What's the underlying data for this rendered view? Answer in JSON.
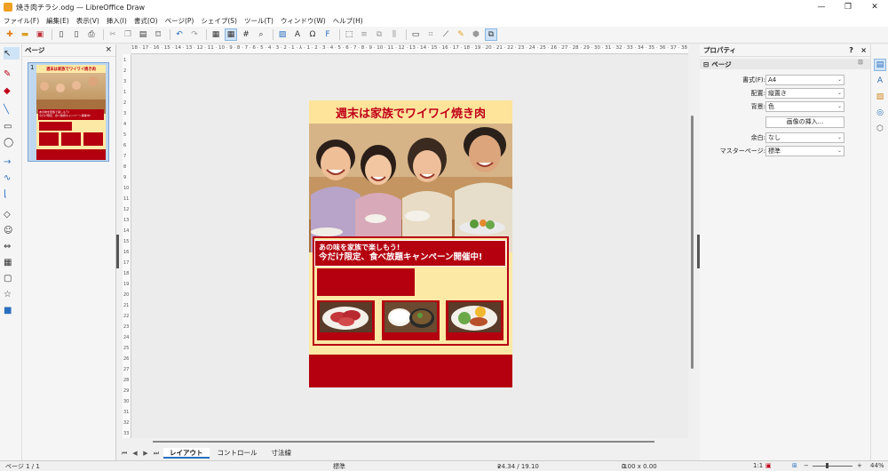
{
  "window": {
    "title": "焼き肉チラシ.odg — LibreOffice Draw",
    "minimize": "—",
    "maximize": "❐",
    "close": "✕"
  },
  "menu": [
    "ファイル(F)",
    "編集(E)",
    "表示(V)",
    "挿入(I)",
    "書式(O)",
    "ページ(P)",
    "シェイプ(S)",
    "ツール(T)",
    "ウィンドウ(W)",
    "ヘルプ(H)"
  ],
  "pages_panel": {
    "title": "ページ",
    "close": "×",
    "page_number": "1"
  },
  "thumbnail": {
    "headline": "週末は家族でワイワイ焼き肉",
    "line1": "あの味を家族で楽しもう!",
    "line2": "今だけ限定、食べ放題キャンペーン開催中!"
  },
  "ruler": {
    "h": "18 · 17 · 16 · 15 · 14 · 13 · 12 · 11 · 10 · 9 · 8 · 7 · 6 · 5 · 4 · 3 · 2 · 1 · ⅄ · 1 · 2 · 3 · 4 · 5 · 6 · 7 · 8 · 9 · 10 · 11 · 12 · 13 · 14 · 15 · 16 · 17 · 18 · 19 · 20 · 21 · 22 · 23 · 24 · 25 · 26 · 27 · 28 · 29 · 30 · 31 · 32 · 33 · 34 · 35 · 36 · 37 · 38 · 39",
    "v": [
      "1",
      "2",
      "3",
      "1",
      "2",
      "3",
      "4",
      "5",
      "6",
      "7",
      "8",
      "9",
      "10",
      "11",
      "12",
      "13",
      "14",
      "15",
      "16",
      "17",
      "18",
      "19",
      "20",
      "21",
      "22",
      "23",
      "24",
      "25",
      "26",
      "27",
      "28",
      "29",
      "30",
      "31",
      "32",
      "33"
    ]
  },
  "poster": {
    "headline": "週末は家族でワイワイ焼き肉",
    "banner_line1": "あの味を家族で楽しもう!",
    "banner_line2": "今だけ限定、食べ放題キャンペーン開催中!",
    "colors": {
      "red": "#b4000f",
      "headline_text": "#c0001a",
      "background": "#fde9a6"
    }
  },
  "properties": {
    "title": "プロパティ",
    "help": "?",
    "close": "×",
    "section": "ページ",
    "format_label": "書式(F):",
    "format_value": "A4",
    "orientation_label": "配置:",
    "orientation_value": "縦置き",
    "background_label": "背景:",
    "background_value": "色",
    "insert_image_button": "画像の挿入...",
    "margin_label": "余白:",
    "margin_value": "なし",
    "master_label": "マスターページ:",
    "master_value": "標準"
  },
  "tabs": {
    "layout": "レイアウト",
    "controls": "コントロール",
    "dimension": "寸法線"
  },
  "status": {
    "page": "ページ 1 / 1",
    "master": "標準",
    "position": "24.34 / 19.10",
    "size": "0.00 x 0.00",
    "scale": "1:1",
    "zoom": "44%"
  }
}
